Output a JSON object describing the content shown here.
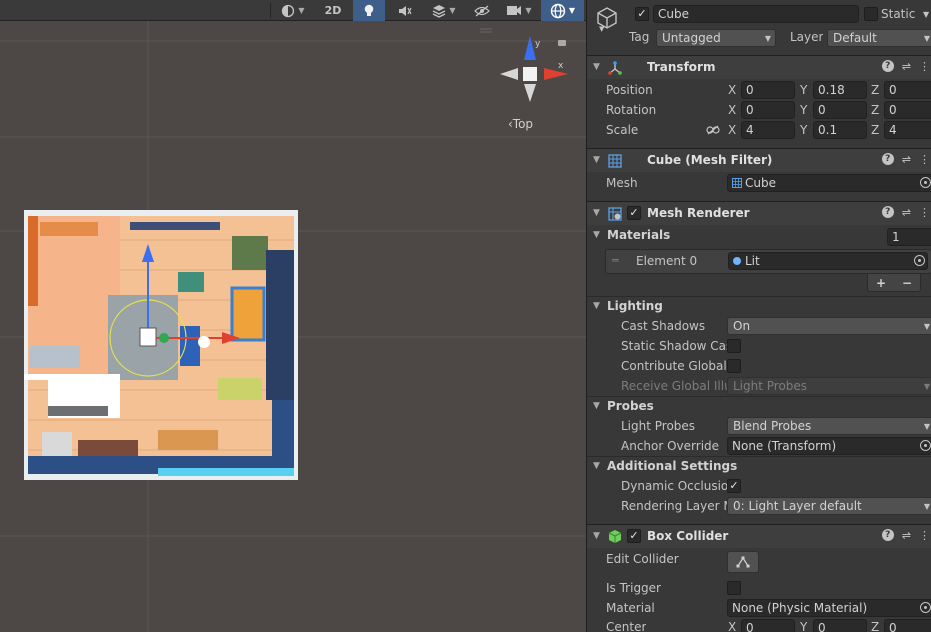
{
  "scene_view": {
    "toolbar": {
      "shading_icon": "shading-mode-icon",
      "mode_2d_label": "2D",
      "lighting_icon": "lightbulb-icon",
      "audio_icon": "audio-mute-icon",
      "effects_icon": "effects-layers-icon",
      "hidden_icon": "eye-slash-icon",
      "camera_icon": "camera-icon",
      "gizmos_icon": "gizmos-globe-icon"
    },
    "orientation_gizmo": {
      "view_label": "‹Top",
      "x_label": "x",
      "y_label": "y"
    }
  },
  "inspector": {
    "object": {
      "enabled": true,
      "name": "Cube",
      "static_label": "Static",
      "static_checked": false,
      "tag_label": "Tag",
      "tag_value": "Untagged",
      "layer_label": "Layer",
      "layer_value": "Default"
    },
    "transform": {
      "title": "Transform",
      "position_label": "Position",
      "rotation_label": "Rotation",
      "scale_label": "Scale",
      "x": "X",
      "y": "Y",
      "z": "Z",
      "position": {
        "x": "0",
        "y": "0.18",
        "z": "0"
      },
      "rotation": {
        "x": "0",
        "y": "0",
        "z": "0"
      },
      "scale": {
        "x": "4",
        "y": "0.1",
        "z": "4"
      }
    },
    "mesh_filter": {
      "title": "Cube (Mesh Filter)",
      "mesh_label": "Mesh",
      "mesh_value": "Cube"
    },
    "mesh_renderer": {
      "title": "Mesh Renderer",
      "enabled": true,
      "materials_label": "Materials",
      "materials_count": "1",
      "element0_label": "Element 0",
      "element0_value": "Lit",
      "add": "+",
      "remove": "−",
      "lighting_label": "Lighting",
      "cast_shadows_label": "Cast Shadows",
      "cast_shadows_value": "On",
      "static_shadow_label": "Static Shadow Cas",
      "contribute_gi_label": "Contribute Global I",
      "receive_gi_label": "Receive Global Illu",
      "receive_gi_value": "Light Probes",
      "probes_label": "Probes",
      "light_probes_label": "Light Probes",
      "light_probes_value": "Blend Probes",
      "anchor_override_label": "Anchor Override",
      "anchor_override_value": "None (Transform)",
      "additional_settings_label": "Additional Settings",
      "dynamic_occlusion_label": "Dynamic Occlusior",
      "dynamic_occlusion_checked": true,
      "rendering_layer_label": "Rendering Layer M",
      "rendering_layer_value": "0: Light Layer default"
    },
    "box_collider": {
      "title": "Box Collider",
      "enabled": true,
      "edit_collider_label": "Edit Collider",
      "is_trigger_label": "Is Trigger",
      "material_label": "Material",
      "material_value": "None (Physic Material)",
      "center_label": "Center",
      "center": {
        "x": "0",
        "y": "0",
        "z": "0"
      }
    }
  },
  "colors": {
    "scene_bg": "#4d4846",
    "inspector_bg": "#383838",
    "active_blue": "#3d5f8a",
    "axis_x": "#e0402f",
    "axis_y": "#3b6ff0"
  }
}
